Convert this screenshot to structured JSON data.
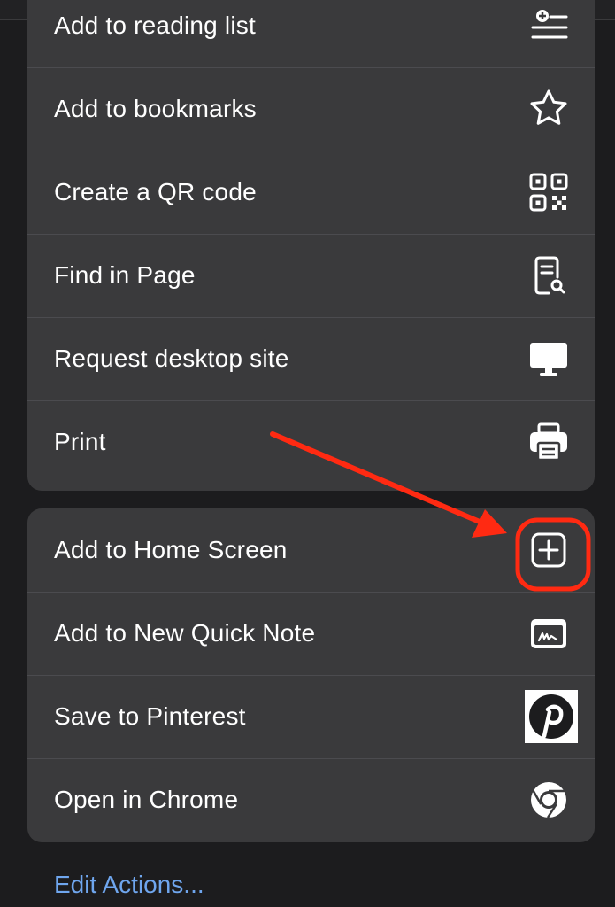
{
  "menu_groups": [
    {
      "items": [
        {
          "label": "Add to reading list",
          "icon": "reading-list-icon"
        },
        {
          "label": "Add to bookmarks",
          "icon": "star-icon"
        },
        {
          "label": "Create a QR code",
          "icon": "qr-code-icon"
        },
        {
          "label": "Find in Page",
          "icon": "find-in-page-icon"
        },
        {
          "label": "Request desktop site",
          "icon": "desktop-icon"
        },
        {
          "label": "Print",
          "icon": "printer-icon"
        }
      ]
    },
    {
      "items": [
        {
          "label": "Add to Home Screen",
          "icon": "add-square-icon"
        },
        {
          "label": "Add to New Quick Note",
          "icon": "quick-note-icon"
        },
        {
          "label": "Save to Pinterest",
          "icon": "pinterest-icon"
        },
        {
          "label": "Open in Chrome",
          "icon": "chrome-icon"
        }
      ]
    }
  ],
  "footer": {
    "edit_actions_label": "Edit Actions..."
  },
  "colors": {
    "background": "#1c1c1e",
    "group_background": "#3a3a3c",
    "link": "#6fa6ee",
    "annotation": "#ff2a12"
  }
}
